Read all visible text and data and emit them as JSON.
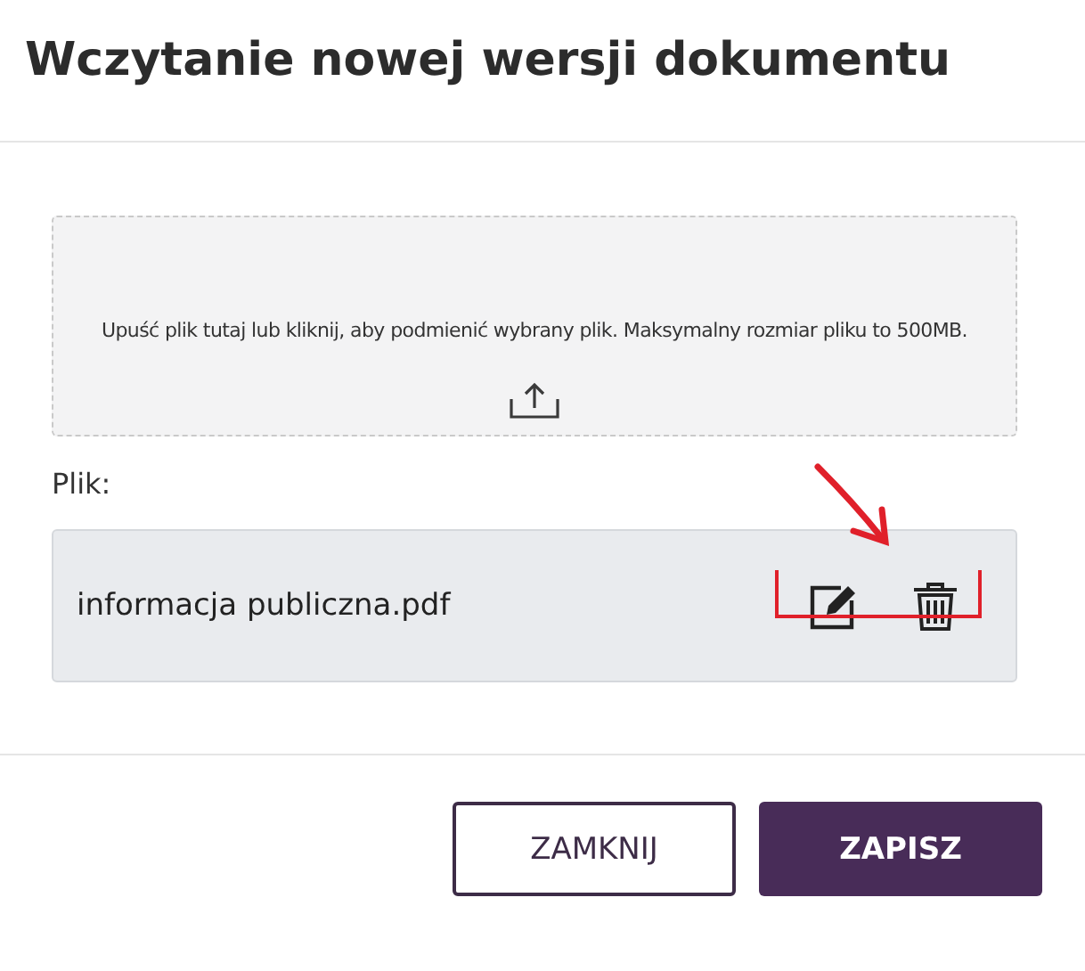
{
  "dialog": {
    "title": "Wczytanie nowej wersji dokumentu"
  },
  "dropzone": {
    "hint": "Upuść plik tutaj lub kliknij, aby podmienić wybrany plik. Maksymalny rozmiar pliku to 500MB."
  },
  "file_label": "Plik:",
  "file": {
    "name": "informacja publiczna.pdf"
  },
  "buttons": [
    {
      "label": "ZAMKNIJ",
      "kind": "secondary"
    },
    {
      "label": "ZAPISZ",
      "kind": "primary"
    }
  ]
}
